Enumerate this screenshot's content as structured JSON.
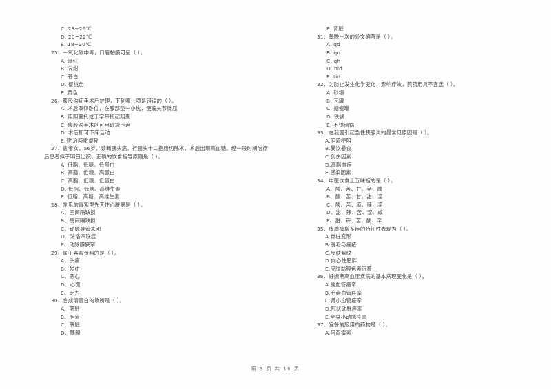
{
  "document": {
    "type": "exam-paper",
    "language": "zh-CN",
    "footer": "第 3 页 共 16 页",
    "page_number": "3",
    "total_pages": "16"
  },
  "left_column": {
    "leading_options": [
      "C. 23~26℃",
      "D. 20~22℃",
      "E. 18~20℃"
    ],
    "questions": [
      {
        "stem": "25、一氧化碳中毒，口唇黏膜可呈（      ）。",
        "options": [
          "A. 潮红",
          "B. 发绀",
          "C. 苍白",
          "D. 樱桃色",
          "E. 黄色"
        ]
      },
      {
        "stem": "26、腹股沟疝手术后护理，下列哪一项是错误的（       ）。",
        "options": [
          "A. 术后取仰卧位，在膝部垫一小枕，使髋关节微屈",
          "B. 用阴囊托或丁字带托起阴囊",
          "C. 腹股沟手术区可用砂袋压迫",
          "D. 术后即可下床活动",
          "E. 防治咳嗽便秘"
        ]
      },
      {
        "stem": "27、患者女，56岁，诊断胰头癌，行胰头十二指肠切除术，术后出现高血糖。经一段时间治疗",
        "stem_cont": "后患者拟于明日出院，正确的饮食指导原则是（      ）。",
        "options": [
          "A. 低脂、低糖、低蛋白",
          "B. 高脂、低糖、高蛋白",
          "C. 高脂、低糖、低蛋白",
          "D. 低脂、低糖、高维生素",
          "E. 低脂、高糖、高维生素"
        ]
      },
      {
        "stem": "28、常见的青紫型先天性心脏病是（      ）。",
        "options": [
          "A、室间隔缺损",
          "B、房间隔缺损",
          "C、动脉导管未闭",
          "D、法洛四联症",
          "E、动脉瓣狭窄"
        ]
      },
      {
        "stem": "29、属于客观资料的是（      ）。",
        "options": [
          "A、头痛",
          "B、发绀",
          "C、恶心",
          "D、心慌",
          "E、乏力"
        ]
      },
      {
        "stem": "30、合成清蛋白的场所是（      ）。",
        "options": [
          "A、肝脏",
          "B、胆道",
          "C、脾脏",
          "D、胰腺"
        ]
      }
    ]
  },
  "right_column": {
    "leading_options": [
      "E. 肾脏"
    ],
    "questions": [
      {
        "stem": "31、每晚一次的外文缩写是（      ）。",
        "options": [
          "A. qd",
          "B. qn",
          "C. qh",
          "D. bid",
          "E. tid"
        ]
      },
      {
        "stem": "32、为防止发生化学变化，影响疗效，煎药用具不宜选（      ）。",
        "options": [
          "A. 砂锅",
          "B. 瓦罐",
          "C. 搪瓷罐",
          "D. 铁锅",
          "E. 不锈钢锅"
        ]
      },
      {
        "stem": "33、在我国引起急性胰腺炎的最常见原因是（      ）。",
        "options": [
          "A.胆道梗阻",
          "B.暴饮暴食",
          "C.创伤因素",
          "D.高脂血症",
          "E.感染因素"
        ]
      },
      {
        "stem": "34、中医饮食上五味指的是（      ）。",
        "options": [
          "A、酸、苦、甘、辛、咸",
          "B、酸、苦、甘、甜、涩",
          "C、酸、苦、麻、辣、涩",
          "D、甜、辣、苦、涩、咸",
          "E、甜、辣、苦、酸、辛"
        ]
      },
      {
        "stem": "35、皮质醇增多症的特征性表现为（      ）。",
        "options": [
          "A.脊柱变形",
          "B.脱毛与痤疮",
          "C.皮肤紫纹",
          "D.向心性肥胖",
          "E.皮肤黏膜色素沉着"
        ]
      },
      {
        "stem": "36、妊娠期高血压疾病的基本病理变化是（      ）。",
        "options": [
          "A.脑血管痉挛",
          "B.胎盘血管痉挛",
          "C.肾小血管痉挛",
          "D.冠状动脉痉挛",
          "E.全身小动脉痉挛"
        ]
      },
      {
        "stem": "37、宜餐前服用的药物是（      ）。",
        "options": [
          "A.阿奇霉素"
        ]
      }
    ]
  }
}
